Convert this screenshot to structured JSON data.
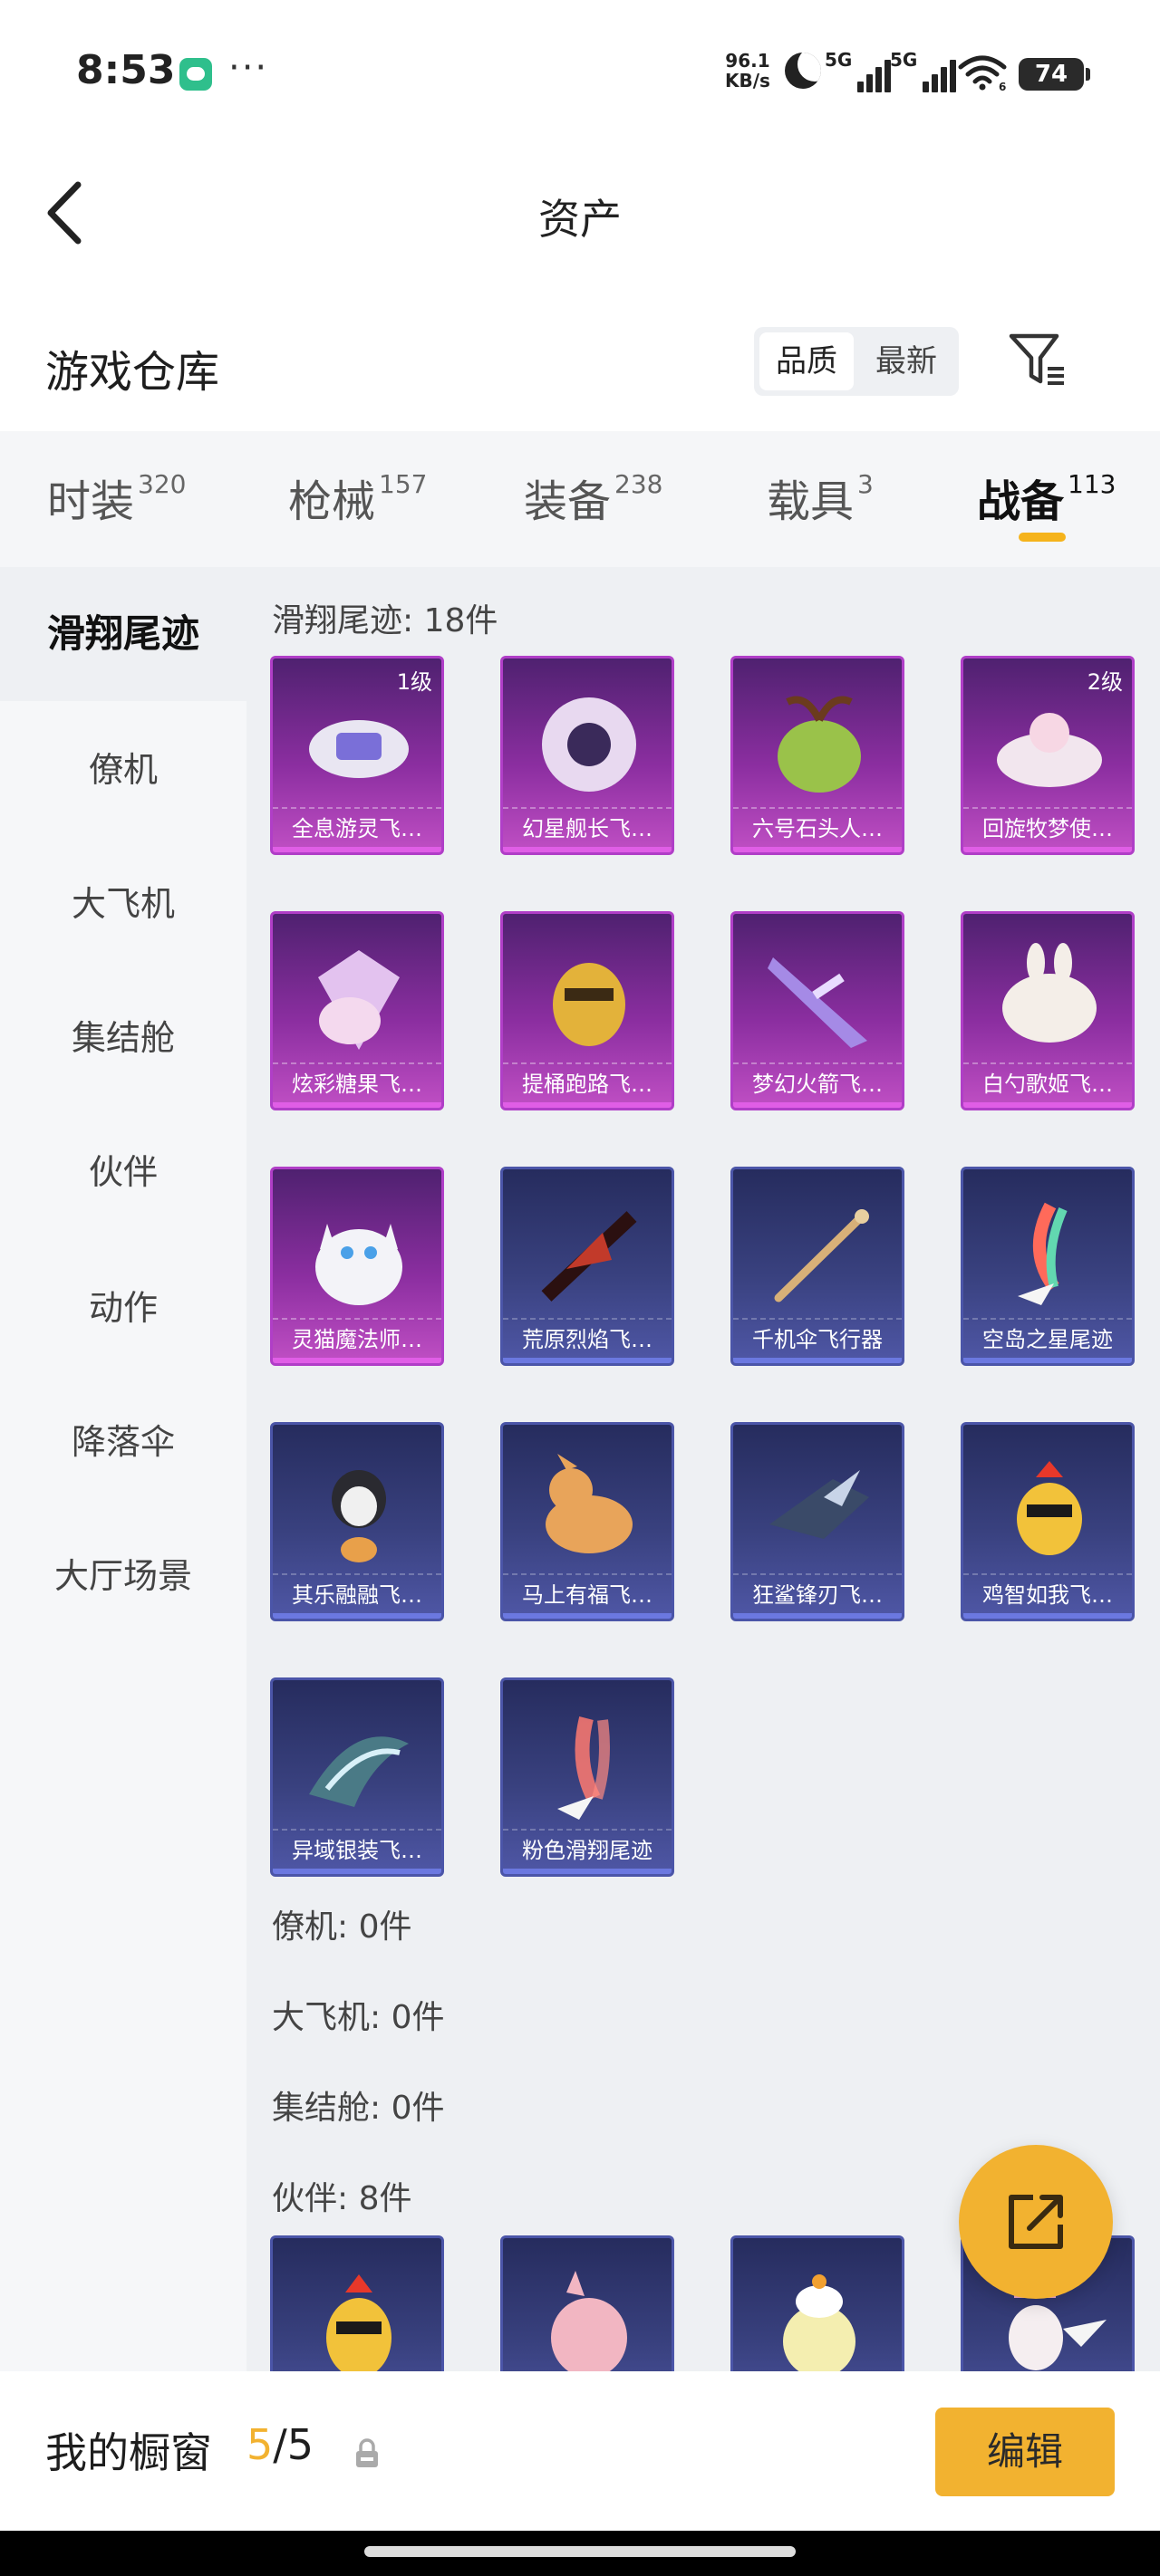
{
  "status_bar": {
    "time": "8:53",
    "dots": "···",
    "net_speed_value": "96.1",
    "net_speed_unit": "KB/s",
    "sim1": "5G",
    "sim2": "5G",
    "wifi_sub": "6",
    "battery": "74"
  },
  "header": {
    "title": "资产"
  },
  "warehouse": {
    "title": "游戏仓库",
    "sort_quality": "品质",
    "sort_newest": "最新"
  },
  "tabs": [
    {
      "label": "时装",
      "count": "320"
    },
    {
      "label": "枪械",
      "count": "157"
    },
    {
      "label": "装备",
      "count": "238"
    },
    {
      "label": "载具",
      "count": "3"
    },
    {
      "label": "战备",
      "count": "113"
    }
  ],
  "sidebar": [
    "滑翔尾迹",
    "僚机",
    "大飞机",
    "集结舱",
    "伙伴",
    "动作",
    "降落伞",
    "大厅场景"
  ],
  "sections": {
    "glide_trail": "滑翔尾迹: 18件",
    "wingman": "僚机: 0件",
    "big_plane": "大飞机: 0件",
    "rally_pod": "集结舱: 0件",
    "partner": "伙伴: 8件"
  },
  "items": [
    {
      "name": "全息游灵飞…",
      "level": "1级",
      "rarity": "purple",
      "icon": "hologram-glider-icon"
    },
    {
      "name": "幻星舰长飞…",
      "level": "",
      "rarity": "purple",
      "icon": "star-captain-glider-icon"
    },
    {
      "name": "六号石头人…",
      "level": "",
      "rarity": "purple",
      "icon": "stone-sprout-glider-icon"
    },
    {
      "name": "回旋牧梦使…",
      "level": "2级",
      "rarity": "purple",
      "icon": "dream-cake-glider-icon"
    },
    {
      "name": "炫彩糖果飞…",
      "level": "",
      "rarity": "purple",
      "icon": "candy-glider-icon"
    },
    {
      "name": "提桶跑路飞…",
      "level": "",
      "rarity": "purple",
      "icon": "bee-bucket-glider-icon"
    },
    {
      "name": "梦幻火箭飞…",
      "level": "",
      "rarity": "purple",
      "icon": "dream-rocket-glider-icon"
    },
    {
      "name": "白勺歌姬飞…",
      "level": "",
      "rarity": "purple",
      "icon": "bunny-cloud-glider-icon"
    },
    {
      "name": "灵猫魔法师…",
      "level": "",
      "rarity": "purple",
      "icon": "magic-cat-glider-icon"
    },
    {
      "name": "荒原烈焰飞…",
      "level": "",
      "rarity": "blue",
      "icon": "wasteland-flame-glider-icon"
    },
    {
      "name": "千机伞飞行器",
      "level": "",
      "rarity": "blue",
      "icon": "umbrella-glider-icon"
    },
    {
      "name": "空岛之星尾迹",
      "level": "",
      "rarity": "blue",
      "icon": "rainbow-trail-icon"
    },
    {
      "name": "其乐融融飞…",
      "level": "",
      "rarity": "blue",
      "icon": "penguin-glider-icon"
    },
    {
      "name": "马上有福飞…",
      "level": "",
      "rarity": "blue",
      "icon": "pony-glider-icon"
    },
    {
      "name": "狂鲨锋刃飞…",
      "level": "",
      "rarity": "blue",
      "icon": "shark-glider-icon"
    },
    {
      "name": "鸡智如我飞…",
      "level": "",
      "rarity": "blue",
      "icon": "chicken-glider-icon"
    },
    {
      "name": "异域银装飞…",
      "level": "",
      "rarity": "blue",
      "icon": "silver-wing-glider-icon"
    },
    {
      "name": "粉色滑翔尾迹",
      "level": "",
      "rarity": "blue",
      "icon": "pink-trail-icon"
    }
  ],
  "partner_items": [
    {
      "icon": "partner-chicken-icon"
    },
    {
      "icon": "partner-pink-pig-icon"
    },
    {
      "icon": "partner-chick-icon"
    },
    {
      "icon": "partner-angel-icon"
    }
  ],
  "bottom_bar": {
    "label": "我的橱窗",
    "current": "5",
    "separator": "/",
    "total": "5",
    "edit_label": "编辑"
  },
  "colors": {
    "accent": "#f2b230",
    "purple_rarity": "#b03ec7",
    "blue_rarity": "#4b55a8"
  }
}
